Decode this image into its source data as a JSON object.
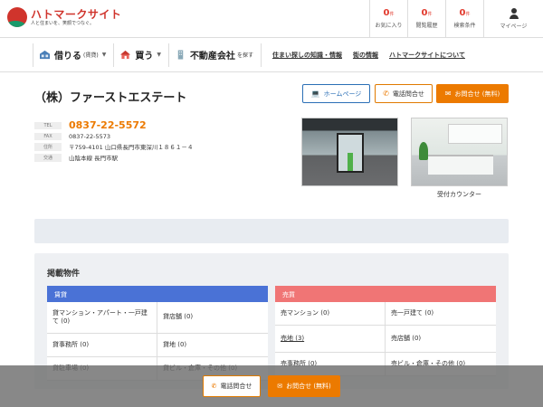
{
  "header": {
    "logo_name": "ハトマークサイト",
    "logo_tagline": "人と住まいを、笑顔でつなぐ。",
    "stats": [
      {
        "count": "0",
        "unit": "件",
        "label": "お気に入り"
      },
      {
        "count": "0",
        "unit": "件",
        "label": "閲覧履歴"
      },
      {
        "count": "0",
        "unit": "件",
        "label": "検索条件"
      }
    ],
    "mypage_label": "マイページ"
  },
  "nav": {
    "rent_label": "借りる",
    "rent_sub": "(賃貸)",
    "buy_label": "買う",
    "agency_label": "不動産会社",
    "agency_sub": "を探す",
    "links": [
      "住まい探しの知識・情報",
      "街の情報",
      "ハトマークサイトについて"
    ]
  },
  "company": {
    "name": "（株）ファーストエステート",
    "buttons": {
      "homepage": "ホームページ",
      "phone": "電話問合せ",
      "inquiry": "お問合せ (無料)"
    },
    "info": {
      "tel_label": "TEL",
      "tel": "0837-22-5572",
      "fax_label": "FAX",
      "fax": "0837-22-5573",
      "address_label": "住所",
      "address": "〒759-4101 山口県長門市東深川１８６１－４",
      "transit_label": "交通",
      "transit": "山陰本線 長門市駅"
    },
    "photo_caption": "受付カウンター"
  },
  "listings": {
    "title": "掲載物件",
    "rent": {
      "header": "賃貸",
      "items": [
        "貸マンション・アパート・一戸建て (0)",
        "貸店舗 (0)",
        "貸事務所 (0)",
        "貸地 (0)",
        "貸駐車場 (0)",
        "貸ビル・倉庫・その他 (0)"
      ]
    },
    "sale": {
      "header": "売買",
      "items": [
        "売マンション (0)",
        "売一戸建て (0)",
        "売地 (3)",
        "売店舗 (0)",
        "売事務所 (0)",
        "売ビル・倉庫・その他 (0)"
      ]
    }
  },
  "bottom_bar": {
    "phone": "電話問合せ",
    "inquiry": "お問合せ (無料)"
  },
  "colors": {
    "brand_red": "#d0342c",
    "accent_orange": "#ec7a00",
    "rent_blue": "#4a72d6",
    "sale_red": "#f07575"
  }
}
